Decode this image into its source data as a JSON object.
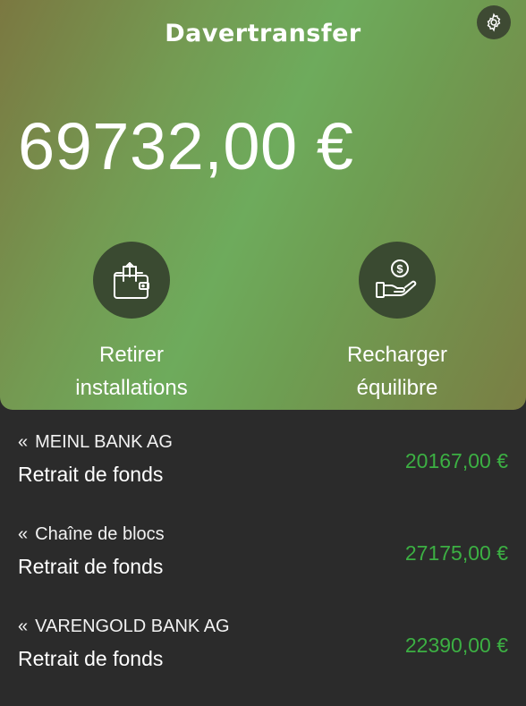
{
  "app": {
    "title": "Davertransfer",
    "balance": "69732,00 €"
  },
  "actions": [
    {
      "label_line1": "Retirer",
      "label_line2": "installations",
      "icon": "wallet-withdraw-icon"
    },
    {
      "label_line1": "Recharger",
      "label_line2": "équilibre",
      "icon": "hand-coin-icon"
    }
  ],
  "transactions": [
    {
      "bank": "MEINL BANK AG",
      "description": "Retrait de fonds",
      "amount": "20167,00 €"
    },
    {
      "bank": "Chaîne de blocs",
      "description": "Retrait de fonds",
      "amount": "27175,00 €"
    },
    {
      "bank": "VARENGOLD BANK AG",
      "description": "Retrait de fonds",
      "amount": "22390,00 €"
    }
  ],
  "icons": {
    "settings": "gear-icon",
    "transaction_prefix": "double-chevron-left-icon",
    "transaction_prefix_glyph": "«"
  },
  "colors": {
    "background": "#2b2b2b",
    "amount_positive": "#3cb043",
    "card_gradient_center": "#6eab5c",
    "card_gradient_edge": "#7a7e44",
    "icon_circle": "#3a4a31"
  }
}
